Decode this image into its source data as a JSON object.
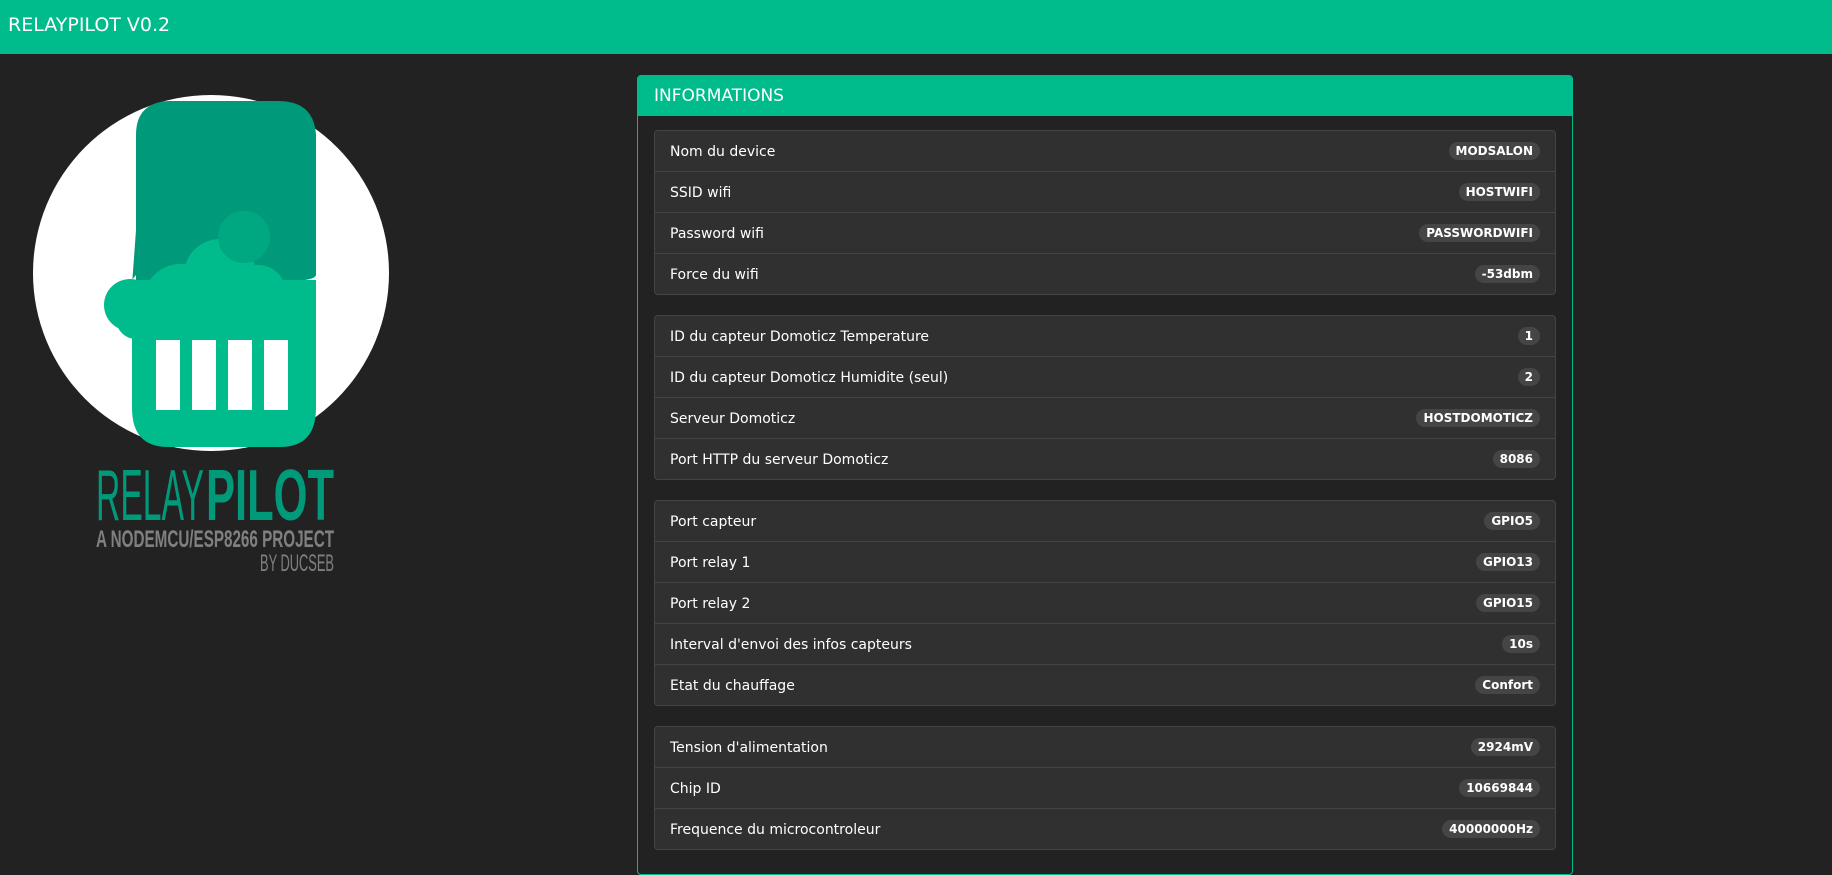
{
  "navbar": {
    "brand": "RELAYPILOT V0.2"
  },
  "logo": {
    "icon": "relaypilot-logo",
    "wordmark_light": "RELAY",
    "wordmark_bold": "PILOT",
    "tagline": "A NODEMCU/ESP8266 PROJECT",
    "byline": "BY DUCSEB",
    "colors": {
      "brand": "#00bc8c",
      "dark_green": "#009a7a",
      "gray": "#808080",
      "white": "#ffffff"
    }
  },
  "panel": {
    "title": "INFORMATIONS",
    "groups": [
      {
        "items": [
          {
            "label": "Nom du device",
            "value": "MODSALON"
          },
          {
            "label": "SSID wifi",
            "value": "HOSTWIFI"
          },
          {
            "label": "Password wifi",
            "value": "PASSWORDWIFI"
          },
          {
            "label": "Force du wifi",
            "value": "-53dbm"
          }
        ]
      },
      {
        "items": [
          {
            "label": "ID du capteur Domoticz Temperature",
            "value": "1"
          },
          {
            "label": "ID du capteur Domoticz Humidite (seul)",
            "value": "2"
          },
          {
            "label": "Serveur Domoticz",
            "value": "HOSTDOMOTICZ"
          },
          {
            "label": "Port HTTP du serveur Domoticz",
            "value": "8086"
          }
        ]
      },
      {
        "items": [
          {
            "label": "Port capteur",
            "value": "GPIO5"
          },
          {
            "label": "Port relay 1",
            "value": "GPIO13"
          },
          {
            "label": "Port relay 2",
            "value": "GPIO15"
          },
          {
            "label": "Interval d'envoi des infos capteurs",
            "value": "10s"
          },
          {
            "label": "Etat du chauffage",
            "value": "Confort"
          }
        ]
      },
      {
        "items": [
          {
            "label": "Tension d'alimentation",
            "value": "2924mV"
          },
          {
            "label": "Chip ID",
            "value": "10669844"
          },
          {
            "label": "Frequence du microcontroleur",
            "value": "40000000Hz"
          }
        ]
      }
    ]
  },
  "theme": {
    "accent": "#00bc8c",
    "background": "#222222",
    "list_bg": "#303030",
    "list_border": "#444444",
    "badge_bg": "#464545"
  }
}
